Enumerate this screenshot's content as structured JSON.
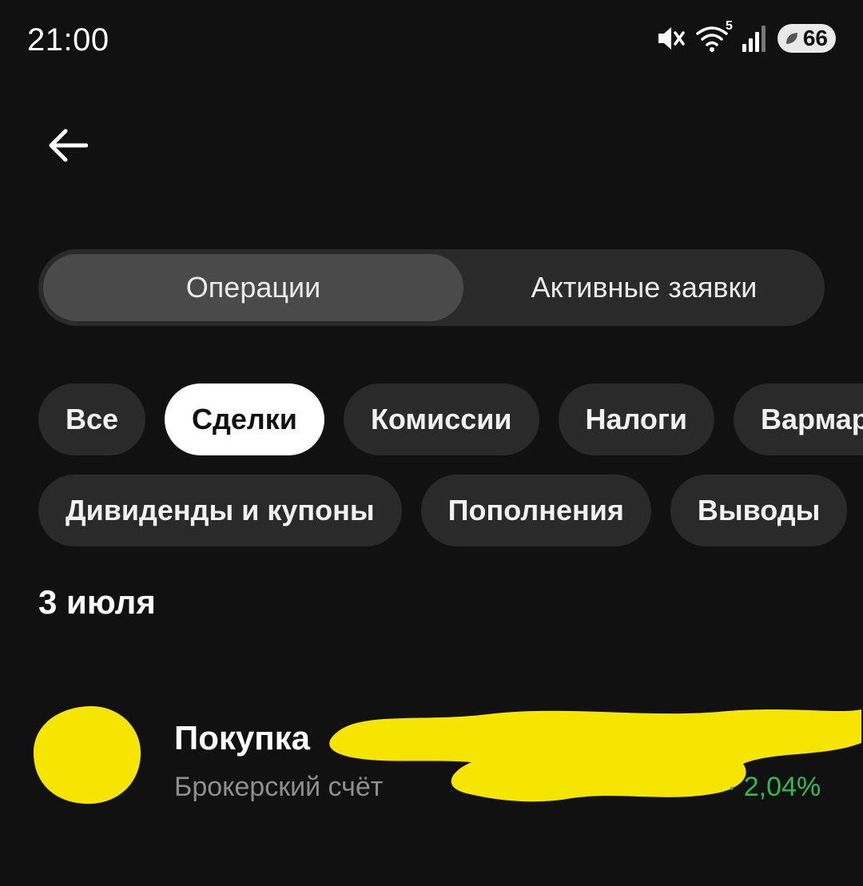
{
  "status_bar": {
    "time": "21:00",
    "wifi_badge": "5",
    "battery": "66",
    "icons": [
      "mute-icon",
      "wifi-icon",
      "signal-icon",
      "battery-icon"
    ]
  },
  "nav": {
    "back_icon": "arrow-left-icon"
  },
  "segmented": {
    "tabs": [
      {
        "label": "Операции",
        "active": true
      },
      {
        "label": "Активные заявки",
        "active": false
      }
    ]
  },
  "filters": {
    "row1": [
      {
        "label": "Все",
        "active": false
      },
      {
        "label": "Сделки",
        "active": true
      },
      {
        "label": "Комиссии",
        "active": false
      },
      {
        "label": "Налоги",
        "active": false
      },
      {
        "label": "Вармар",
        "active": false
      }
    ],
    "row2": [
      {
        "label": "Дивиденды и купоны",
        "active": false
      },
      {
        "label": "Пополнения",
        "active": false
      },
      {
        "label": "Выводы",
        "active": false
      }
    ]
  },
  "feed": {
    "date": "3 июля",
    "items": [
      {
        "title": "Покупка",
        "subtitle": "Брокерский счёт",
        "change": "· 2,04%"
      }
    ]
  },
  "colors": {
    "background": "#111111",
    "chip": "#2a2a2a",
    "chip_active": "#ffffff",
    "positive": "#2dbd4f",
    "redaction": "#f5e500"
  }
}
